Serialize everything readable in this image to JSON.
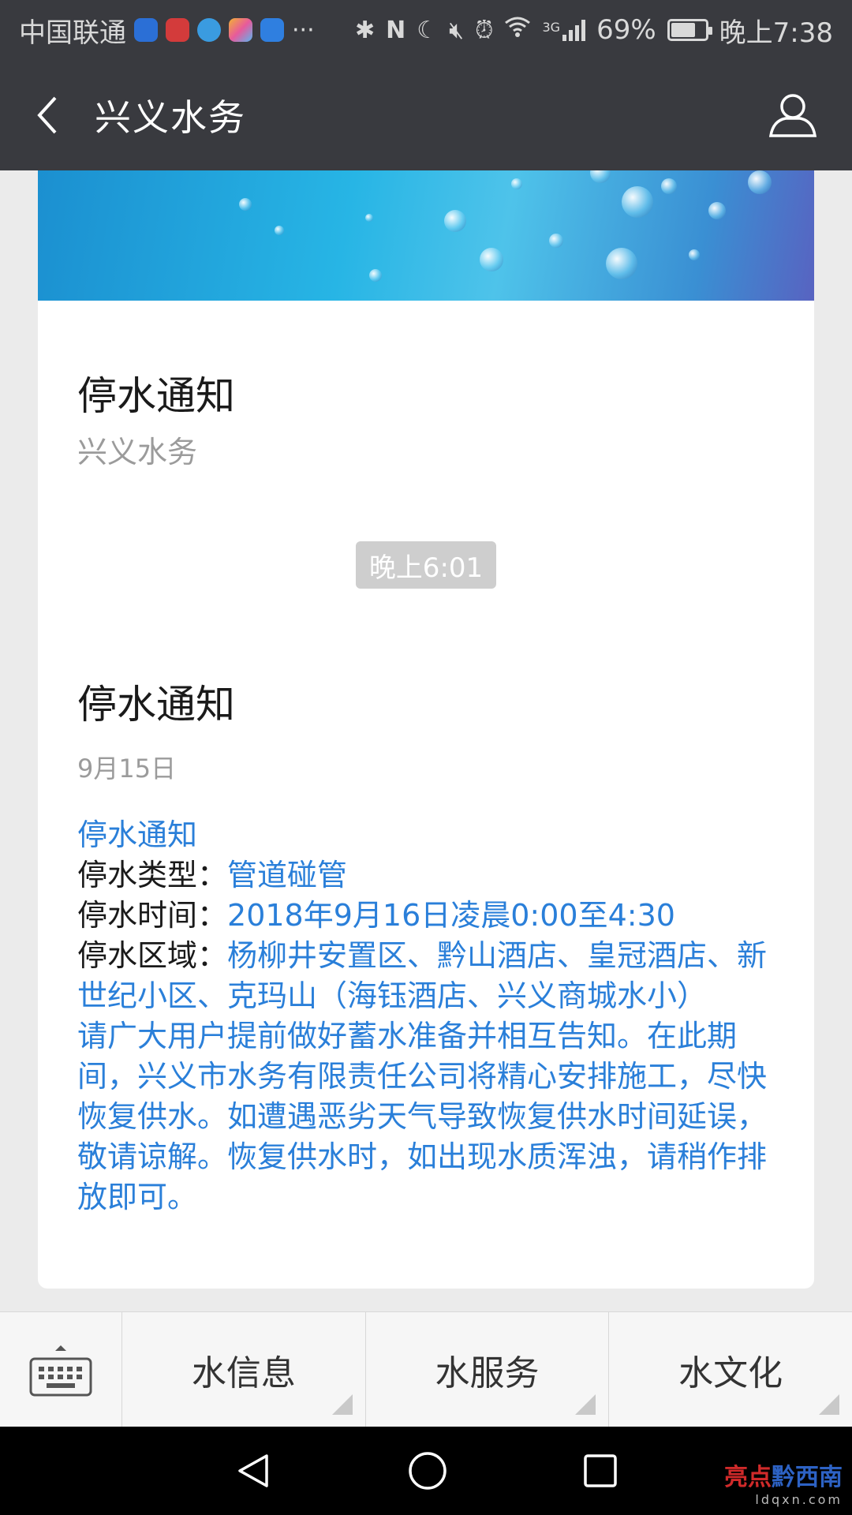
{
  "status_bar": {
    "carrier": "中国联通",
    "battery_percent": "69%",
    "network": "3G",
    "time": "晚上7:38",
    "battery_level": 0.69
  },
  "header": {
    "title": "兴义水务"
  },
  "card1": {
    "title": "停水通知",
    "subtitle": "兴义水务"
  },
  "timestamp": "晚上6:01",
  "card2": {
    "title": "停水通知",
    "date": "9月15日",
    "heading": "停水通知",
    "type_label": "停水类型：",
    "type_value": "管道碰管",
    "time_label": "停水时间：",
    "time_value": "2018年9月16日凌晨0:00至4:30",
    "area_label": "停水区域：",
    "area_value": "杨柳井安置区、黔山酒店、皇冠酒店、新世纪小区、克玛山（海钰酒店、兴义商城水小）",
    "notice": "请广大用户提前做好蓄水准备并相互告知。在此期间，兴义市水务有限责任公司将精心安排施工，尽快恢复供水。如遭遇恶劣天气导致恢复供水时间延误，敬请谅解。恢复供水时，如出现水质浑浊，请稍作排放即可。"
  },
  "menu": {
    "items": [
      "水信息",
      "水服务",
      "水文化"
    ]
  },
  "watermark": {
    "part1": "亮点",
    "part2": "黔西南",
    "url": "ldqxn.com"
  },
  "icons": [
    "back-arrow-icon",
    "profile-icon",
    "keyboard-icon",
    "nav-back-icon",
    "nav-home-icon",
    "nav-recents-icon"
  ]
}
